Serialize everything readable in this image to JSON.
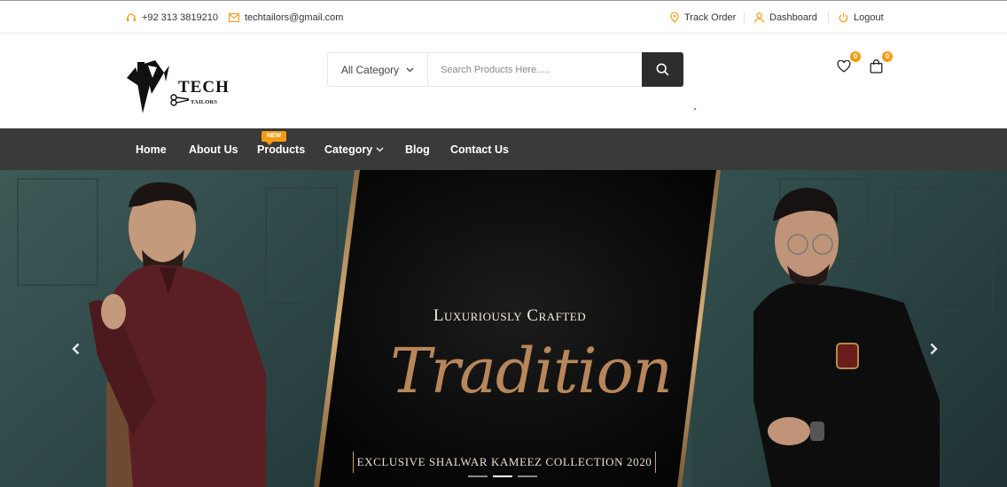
{
  "topbar": {
    "phone": "+92 313 3819210",
    "email": "techtailors@gmail.com",
    "track_order": "Track Order",
    "dashboard": "Dashboard",
    "logout": "Logout"
  },
  "header": {
    "logo_text": "TECH",
    "logo_subtext": "TAILORS",
    "search": {
      "category": "All Category",
      "placeholder": "Search Products Here....."
    },
    "wishlist_count": "0",
    "cart_count": "0"
  },
  "nav": {
    "items": [
      "Home",
      "About Us",
      "Products",
      "Category",
      "Blog",
      "Contact Us"
    ],
    "new_badge": "NEW"
  },
  "hero": {
    "small_title": "Luxuriously Crafted",
    "script_title": "Tradition",
    "subtitle": "EXCLUSIVE SHALWAR KAMEEZ COLLECTION 2020",
    "active_slide": 2,
    "slide_count": 3
  },
  "colors": {
    "accent": "#f39c12",
    "navbar": "#3a3a3a",
    "search_button": "#2d2d2d",
    "hero_gold": "#b8865a"
  }
}
